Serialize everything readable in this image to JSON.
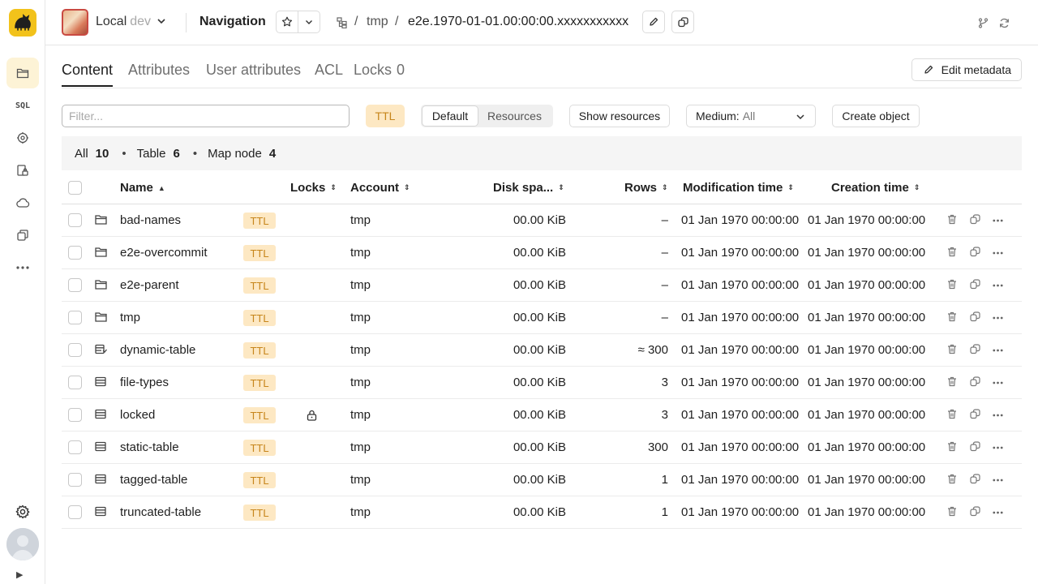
{
  "header": {
    "cluster_name": "Local",
    "cluster_env": "dev",
    "page_title": "Navigation",
    "breadcrumbs": [
      "tmp",
      "e2e.1970-01-01.00:00:00.xxxxxxxxxxx"
    ],
    "separator": "/"
  },
  "sidebar": {
    "sql_label": "SQL"
  },
  "tabs": [
    {
      "label": "Content",
      "active": true
    },
    {
      "label": "Attributes"
    },
    {
      "label": "User attributes"
    },
    {
      "label": "ACL"
    },
    {
      "label": "Locks",
      "count": "0"
    }
  ],
  "edit_metadata_label": "Edit metadata",
  "toolbar": {
    "filter_placeholder": "Filter...",
    "ttl_label": "TTL",
    "segments": [
      "Default",
      "Resources"
    ],
    "show_resources_label": "Show resources",
    "medium_label": "Medium:",
    "medium_value": "All",
    "create_object_label": "Create object"
  },
  "summary": [
    {
      "label": "All",
      "count": "10"
    },
    {
      "label": "Table",
      "count": "6"
    },
    {
      "label": "Map node",
      "count": "4"
    }
  ],
  "columns": {
    "name": "Name",
    "locks": "Locks",
    "account": "Account",
    "disk": "Disk spa...",
    "rows": "Rows",
    "mtime": "Modification time",
    "ctime": "Creation time"
  },
  "rows": [
    {
      "type": "folder",
      "name": "bad-names",
      "ttl": "TTL",
      "locked": false,
      "account": "tmp",
      "disk": "00.00 KiB",
      "rows": "–",
      "mtime": "01 Jan 1970 00:00:00",
      "ctime": "01 Jan 1970 00:00:00"
    },
    {
      "type": "folder",
      "name": "e2e-overcommit",
      "ttl": "TTL",
      "locked": false,
      "account": "tmp",
      "disk": "00.00 KiB",
      "rows": "–",
      "mtime": "01 Jan 1970 00:00:00",
      "ctime": "01 Jan 1970 00:00:00"
    },
    {
      "type": "folder",
      "name": "e2e-parent",
      "ttl": "TTL",
      "locked": false,
      "account": "tmp",
      "disk": "00.00 KiB",
      "rows": "–",
      "mtime": "01 Jan 1970 00:00:00",
      "ctime": "01 Jan 1970 00:00:00"
    },
    {
      "type": "folder",
      "name": "tmp",
      "ttl": "TTL",
      "locked": false,
      "account": "tmp",
      "disk": "00.00 KiB",
      "rows": "–",
      "mtime": "01 Jan 1970 00:00:00",
      "ctime": "01 Jan 1970 00:00:00"
    },
    {
      "type": "dynamic-table",
      "name": "dynamic-table",
      "ttl": "TTL",
      "locked": false,
      "account": "tmp",
      "disk": "00.00 KiB",
      "rows": "≈ 300",
      "mtime": "01 Jan 1970 00:00:00",
      "ctime": "01 Jan 1970 00:00:00"
    },
    {
      "type": "table",
      "name": "file-types",
      "ttl": "TTL",
      "locked": false,
      "account": "tmp",
      "disk": "00.00 KiB",
      "rows": "3",
      "mtime": "01 Jan 1970 00:00:00",
      "ctime": "01 Jan 1970 00:00:00"
    },
    {
      "type": "table",
      "name": "locked",
      "ttl": "TTL",
      "locked": true,
      "account": "tmp",
      "disk": "00.00 KiB",
      "rows": "3",
      "mtime": "01 Jan 1970 00:00:00",
      "ctime": "01 Jan 1970 00:00:00"
    },
    {
      "type": "table",
      "name": "static-table",
      "ttl": "TTL",
      "locked": false,
      "account": "tmp",
      "disk": "00.00 KiB",
      "rows": "300",
      "mtime": "01 Jan 1970 00:00:00",
      "ctime": "01 Jan 1970 00:00:00"
    },
    {
      "type": "table",
      "name": "tagged-table",
      "ttl": "TTL",
      "locked": false,
      "account": "tmp",
      "disk": "00.00 KiB",
      "rows": "1",
      "mtime": "01 Jan 1970 00:00:00",
      "ctime": "01 Jan 1970 00:00:00"
    },
    {
      "type": "table",
      "name": "truncated-table",
      "ttl": "TTL",
      "locked": false,
      "account": "tmp",
      "disk": "00.00 KiB",
      "rows": "1",
      "mtime": "01 Jan 1970 00:00:00",
      "ctime": "01 Jan 1970 00:00:00"
    }
  ],
  "colors": {
    "accent": "#f2c21b",
    "ttl_bg": "#fde8c3",
    "ttl_text": "#c7861c"
  }
}
